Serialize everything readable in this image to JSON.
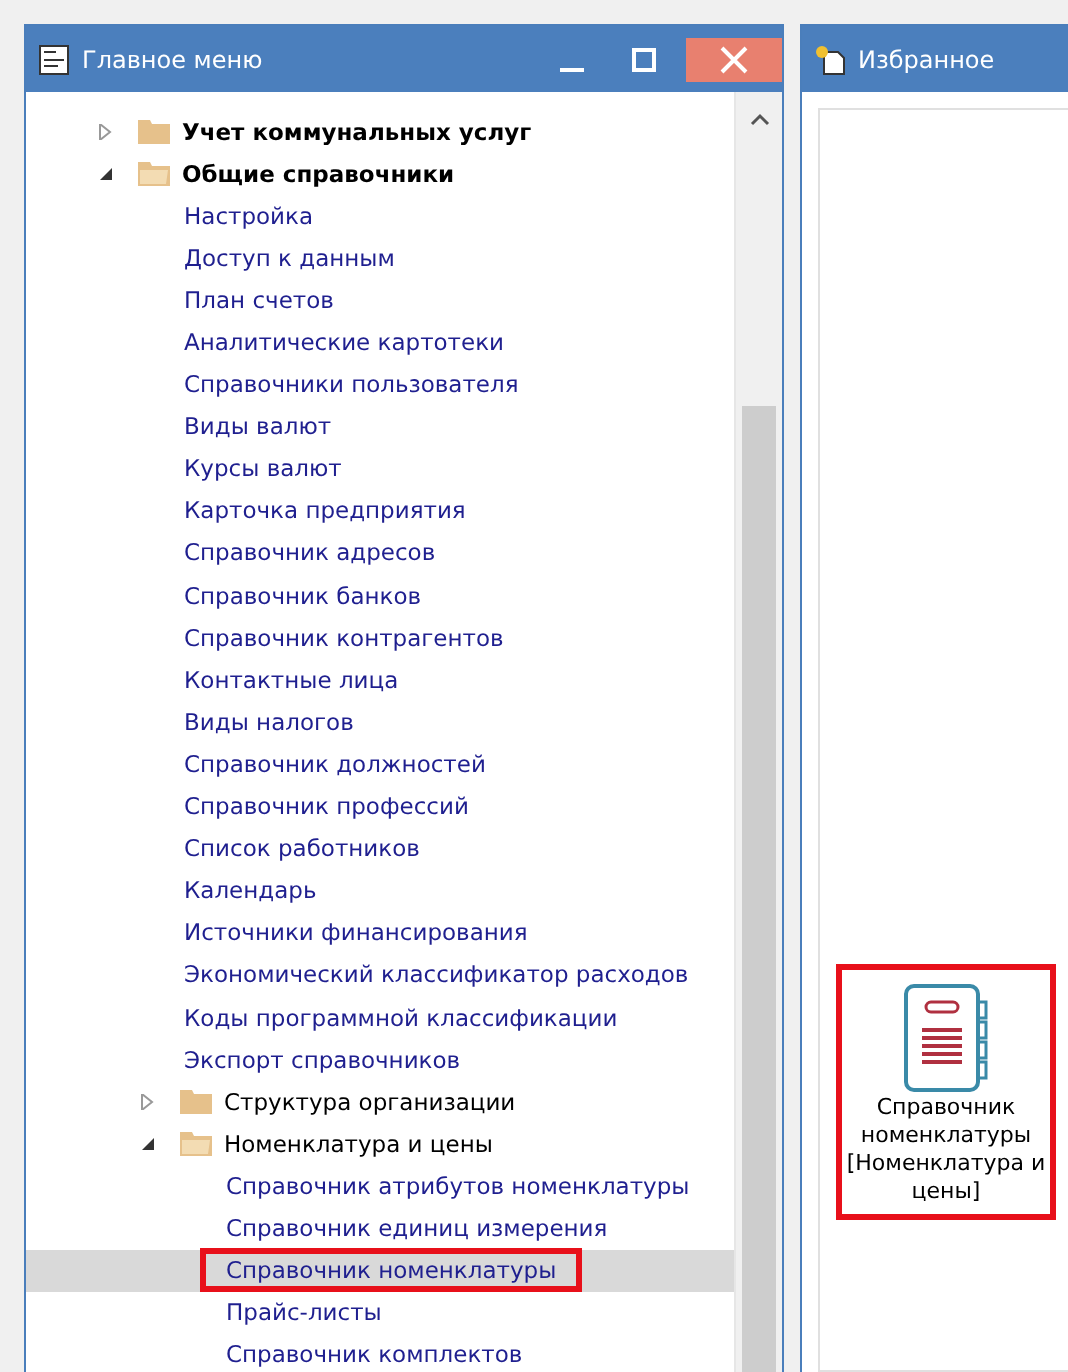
{
  "main_window": {
    "title": "Главное меню"
  },
  "tree": [
    {
      "label": "Учет коммунальных услуг",
      "kind": "folder",
      "bold": true,
      "expanded": false,
      "selected": false,
      "highlighted": false
    },
    {
      "label": "Общие справочники",
      "kind": "folder",
      "bold": true,
      "expanded": true,
      "selected": false,
      "highlighted": false,
      "children": [
        {
          "label": "Настройка",
          "kind": "link",
          "selected": false,
          "highlighted": false
        },
        {
          "label": "Доступ к данным",
          "kind": "link",
          "selected": false,
          "highlighted": false
        },
        {
          "label": "План счетов",
          "kind": "link",
          "selected": false,
          "highlighted": false
        },
        {
          "label": "Аналитические картотеки",
          "kind": "link",
          "selected": false,
          "highlighted": false
        },
        {
          "label": "Справочники пользователя",
          "kind": "link",
          "selected": false,
          "highlighted": false
        },
        {
          "label": "Виды валют",
          "kind": "link",
          "selected": false,
          "highlighted": false
        },
        {
          "label": "Курсы валют",
          "kind": "link",
          "selected": false,
          "highlighted": false
        },
        {
          "label": "Карточка предприятия",
          "kind": "link",
          "selected": false,
          "highlighted": false
        },
        {
          "label": "Справочник адресов",
          "kind": "link",
          "selected": false,
          "highlighted": false
        },
        {
          "label": "Справочник банков",
          "kind": "link",
          "selected": false,
          "highlighted": false
        },
        {
          "label": "Справочник контрагентов",
          "kind": "link",
          "selected": false,
          "highlighted": false
        },
        {
          "label": "Контактные лица",
          "kind": "link",
          "selected": false,
          "highlighted": false
        },
        {
          "label": "Виды налогов",
          "kind": "link",
          "selected": false,
          "highlighted": false
        },
        {
          "label": "Справочник должностей",
          "kind": "link",
          "selected": false,
          "highlighted": false
        },
        {
          "label": "Справочник профессий",
          "kind": "link",
          "selected": false,
          "highlighted": false
        },
        {
          "label": "Список работников",
          "kind": "link",
          "selected": false,
          "highlighted": false
        },
        {
          "label": "Календарь",
          "kind": "link",
          "selected": false,
          "highlighted": false
        },
        {
          "label": "Источники финансирования",
          "kind": "link",
          "selected": false,
          "highlighted": false
        },
        {
          "label": "Экономический классификатор расходов",
          "kind": "link",
          "selected": false,
          "highlighted": false
        },
        {
          "label": "Коды программной классификации",
          "kind": "link",
          "selected": false,
          "highlighted": false
        },
        {
          "label": "Экспорт справочников",
          "kind": "link",
          "selected": false,
          "highlighted": false
        },
        {
          "label": "Структура организации",
          "kind": "folder",
          "bold": false,
          "expanded": false,
          "selected": false,
          "highlighted": false
        },
        {
          "label": "Номенклатура и цены",
          "kind": "folder",
          "bold": false,
          "expanded": true,
          "selected": false,
          "highlighted": false,
          "children": [
            {
              "label": "Справочник атрибутов номенклатуры",
              "kind": "link",
              "selected": false,
              "highlighted": false
            },
            {
              "label": "Справочник единиц измерения",
              "kind": "link",
              "selected": false,
              "highlighted": false
            },
            {
              "label": "Справочник номенклатуры",
              "kind": "link",
              "selected": true,
              "highlighted": true
            },
            {
              "label": "Прайс-листы",
              "kind": "link",
              "selected": false,
              "highlighted": false
            },
            {
              "label": "Справочник комплектов",
              "kind": "link",
              "selected": false,
              "highlighted": false
            }
          ]
        }
      ]
    }
  ],
  "favorites_window": {
    "title": "Избранное"
  },
  "favorites": [
    {
      "label": "Справочник номенклатуры [Номенклатура и цены]",
      "highlighted": true
    }
  ]
}
